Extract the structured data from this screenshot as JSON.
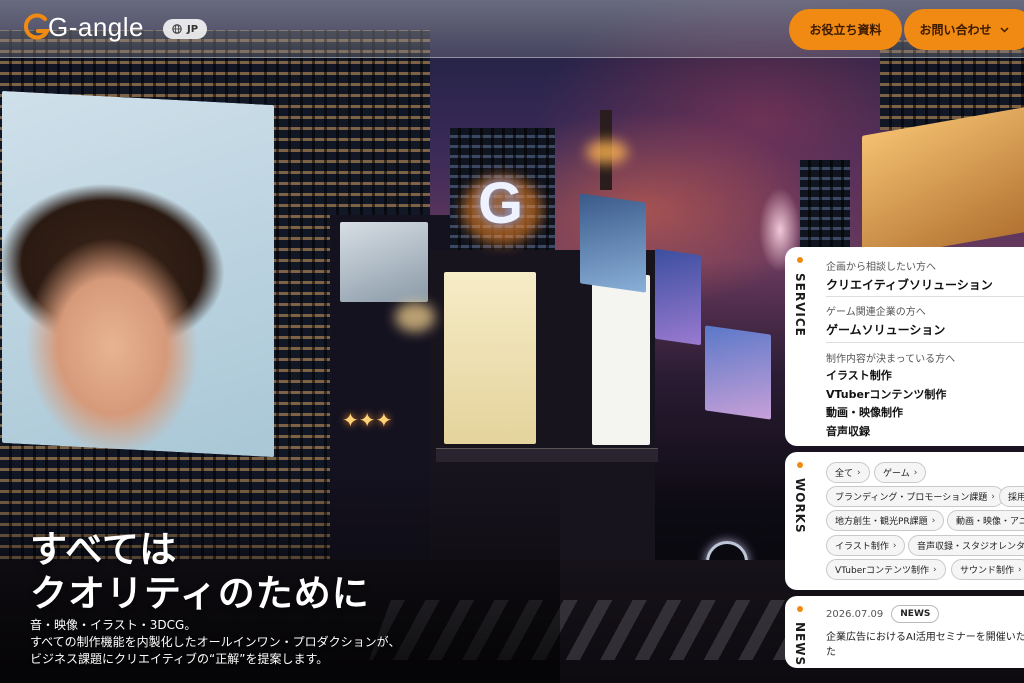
{
  "header": {
    "logo_text": "G-angle",
    "lang_label": "JP",
    "docs_button": "お役立ち資料",
    "contact_button": "お問い合わせ"
  },
  "hero": {
    "headline_line1": "すべては",
    "headline_line2": "クオリティのために",
    "sub_line1": "音・映像・イラスト・3DCG。",
    "sub_line2": "すべての制作機能を内製化したオールインワン・プロダクションが、",
    "sub_line3": "ビジネス課題にクリエイティブの“正解”を提案します。"
  },
  "service": {
    "label": "SERVICE",
    "groups": [
      {
        "note": "企画から相談したい方へ",
        "title": "クリエイティブソリューション"
      },
      {
        "note": "ゲーム関連企業の方へ",
        "title": "ゲームソリューション"
      }
    ],
    "production_note": "制作内容が決まっている方へ",
    "production_items": [
      "イラスト制作",
      "VTuberコンテンツ制作",
      "動画・映像制作",
      "音声収録"
    ]
  },
  "works": {
    "label": "WORKS",
    "chips": [
      "全て",
      "ゲーム",
      "ブランディング・プロモーション課題",
      "採用課",
      "地方創生・観光PR課題",
      "動画・映像・アニメ",
      "イラスト制作",
      "音声収録・スタジオレンタル",
      "VTuberコンテンツ制作",
      "サウンド制作"
    ]
  },
  "news": {
    "label": "NEWS",
    "date": "2026.07.09",
    "badge": "NEWS",
    "title": "企業広告におけるAI活用セミナーを開催いた"
  },
  "colors": {
    "accent": "#f08a12",
    "panel_bg": "#ffffff"
  }
}
